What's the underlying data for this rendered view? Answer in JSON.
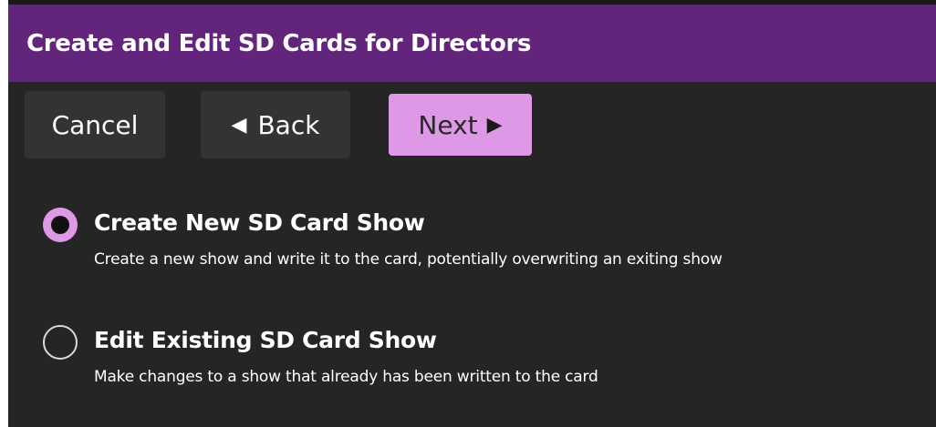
{
  "window": {
    "title": "Create and Edit SD Cards for Directors"
  },
  "toolbar": {
    "cancel_label": "Cancel",
    "back_label": "Back",
    "back_icon": "◀",
    "next_label": "Next",
    "next_icon": "▶"
  },
  "options": [
    {
      "title": "Create New SD Card Show",
      "description": "Create a new show and write it to the card, potentially overwriting an exiting show",
      "selected": true
    },
    {
      "title": "Edit Existing SD Card Show",
      "description": "Make changes to a show that already has been written to the card",
      "selected": false
    }
  ],
  "colors": {
    "titlebar": "#63247b",
    "background": "#252525",
    "button": "#333333",
    "accent": "#dd99e6"
  }
}
